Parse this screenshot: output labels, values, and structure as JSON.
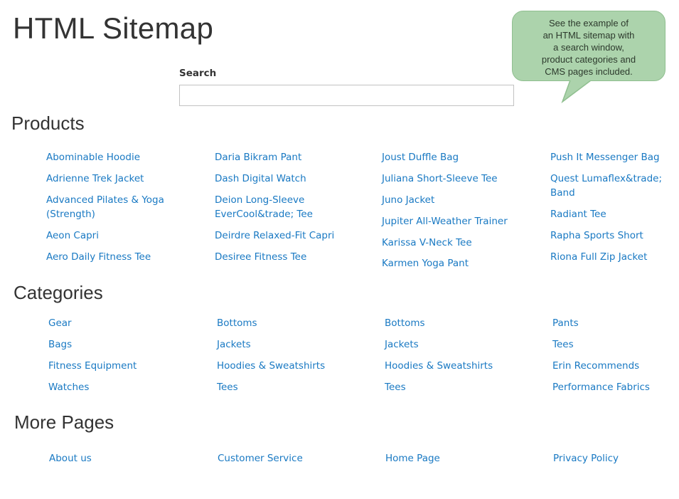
{
  "page": {
    "title": "HTML Sitemap"
  },
  "search": {
    "label": "Search",
    "value": "",
    "placeholder": ""
  },
  "callout": {
    "lines": [
      "See the example of",
      "an HTML sitemap with",
      "a search window,",
      "product categories and",
      "CMS pages included."
    ],
    "background": "#acd3ac"
  },
  "colors": {
    "link": "#1979c3",
    "heading": "#333333"
  },
  "products": {
    "title": "Products",
    "columns": [
      [
        "Abominable Hoodie",
        "Adrienne Trek Jacket",
        "Advanced Pilates & Yoga (Strength)",
        "Aeon Capri",
        "Aero Daily Fitness Tee"
      ],
      [
        "Daria Bikram Pant",
        "Dash Digital Watch",
        "Deion Long-Sleeve EverCool&trade; Tee",
        "Deirdre Relaxed-Fit Capri",
        "Desiree Fitness Tee"
      ],
      [
        "Joust Duffle Bag",
        "Juliana Short-Sleeve Tee",
        "Juno Jacket",
        "Jupiter All-Weather Trainer",
        "Karissa V-Neck Tee",
        "Karmen Yoga Pant"
      ],
      [
        "Push It Messenger Bag",
        "Quest Lumaflex&trade; Band",
        "Radiant Tee",
        "Rapha Sports Short",
        "Riona Full Zip Jacket"
      ]
    ]
  },
  "categories": {
    "title": "Categories",
    "columns": [
      [
        "Gear",
        "Bags",
        "Fitness Equipment",
        "Watches"
      ],
      [
        "Bottoms",
        "Jackets",
        "Hoodies & Sweatshirts",
        "Tees"
      ],
      [
        "Bottoms",
        "Jackets",
        "Hoodies & Sweatshirts",
        "Tees"
      ],
      [
        "Pants",
        "Tees",
        "Erin Recommends",
        "Performance Fabrics"
      ]
    ]
  },
  "more_pages": {
    "title": "More Pages",
    "links": [
      "About us",
      "Customer Service",
      "Home Page",
      "Privacy Policy"
    ]
  }
}
